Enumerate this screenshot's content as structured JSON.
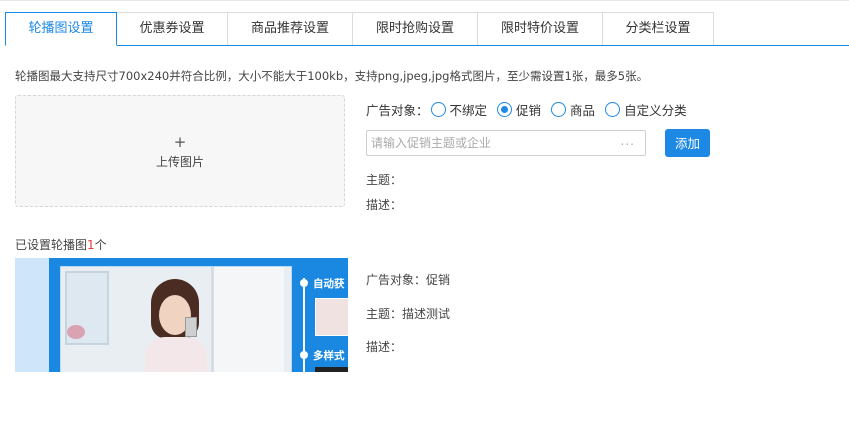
{
  "tabs": [
    {
      "label": "轮播图设置",
      "active": true
    },
    {
      "label": "优惠券设置",
      "active": false
    },
    {
      "label": "商品推荐设置",
      "active": false
    },
    {
      "label": "限时抢购设置",
      "active": false
    },
    {
      "label": "限时特价设置",
      "active": false
    },
    {
      "label": "分类栏设置",
      "active": false
    }
  ],
  "hint": "轮播图最大支持尺寸700x240并符合比例，大小不能大于100kb，支持png,jpeg,jpg格式图片，至少需设置1张，最多5张。",
  "upload": {
    "plus": "+",
    "label": "上传图片"
  },
  "ad_target": {
    "label": "广告对象：",
    "options": [
      {
        "label": "不绑定",
        "checked": false
      },
      {
        "label": "促销",
        "checked": true
      },
      {
        "label": "商品",
        "checked": false
      },
      {
        "label": "自定义分类",
        "checked": false
      }
    ]
  },
  "search": {
    "placeholder": "请输入促销主题或企业",
    "dots": "..."
  },
  "add_button": "添加",
  "form_theme_label": "主题：",
  "form_desc_label": "描述：",
  "configured": {
    "prefix": "已设置轮播图",
    "count": "1",
    "suffix": "个"
  },
  "banner": {
    "text1": "自动获",
    "text2": "多样式"
  },
  "item_info": {
    "ad_target": "广告对象：促销",
    "theme": "主题：描述测试",
    "desc": "描述："
  },
  "colors": {
    "accent": "#1E88E5",
    "count_red": "#E53935"
  }
}
